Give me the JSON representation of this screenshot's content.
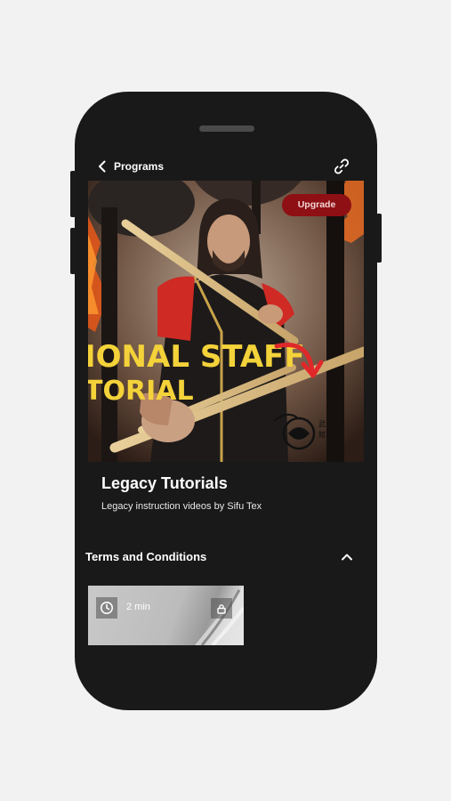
{
  "header": {
    "back_label": "Programs",
    "back_icon": "chevron-left-icon",
    "share_icon": "link-icon"
  },
  "hero": {
    "upgrade_label": "Upgrade",
    "overlay_line1": "IONAL STAFF",
    "overlay_line2": "TORIAL"
  },
  "program": {
    "title": "Legacy Tutorials",
    "description": "Legacy instruction videos by Sifu Tex"
  },
  "terms": {
    "label": "Terms and Conditions",
    "icon": "chevron-up-icon"
  },
  "videos": [
    {
      "duration": "2 min",
      "locked": true
    }
  ],
  "colors": {
    "phone_bg": "#191919",
    "upgrade_bg": "#8e0f14",
    "overlay_text": "#f4d23a",
    "arrow": "#e0282a"
  }
}
